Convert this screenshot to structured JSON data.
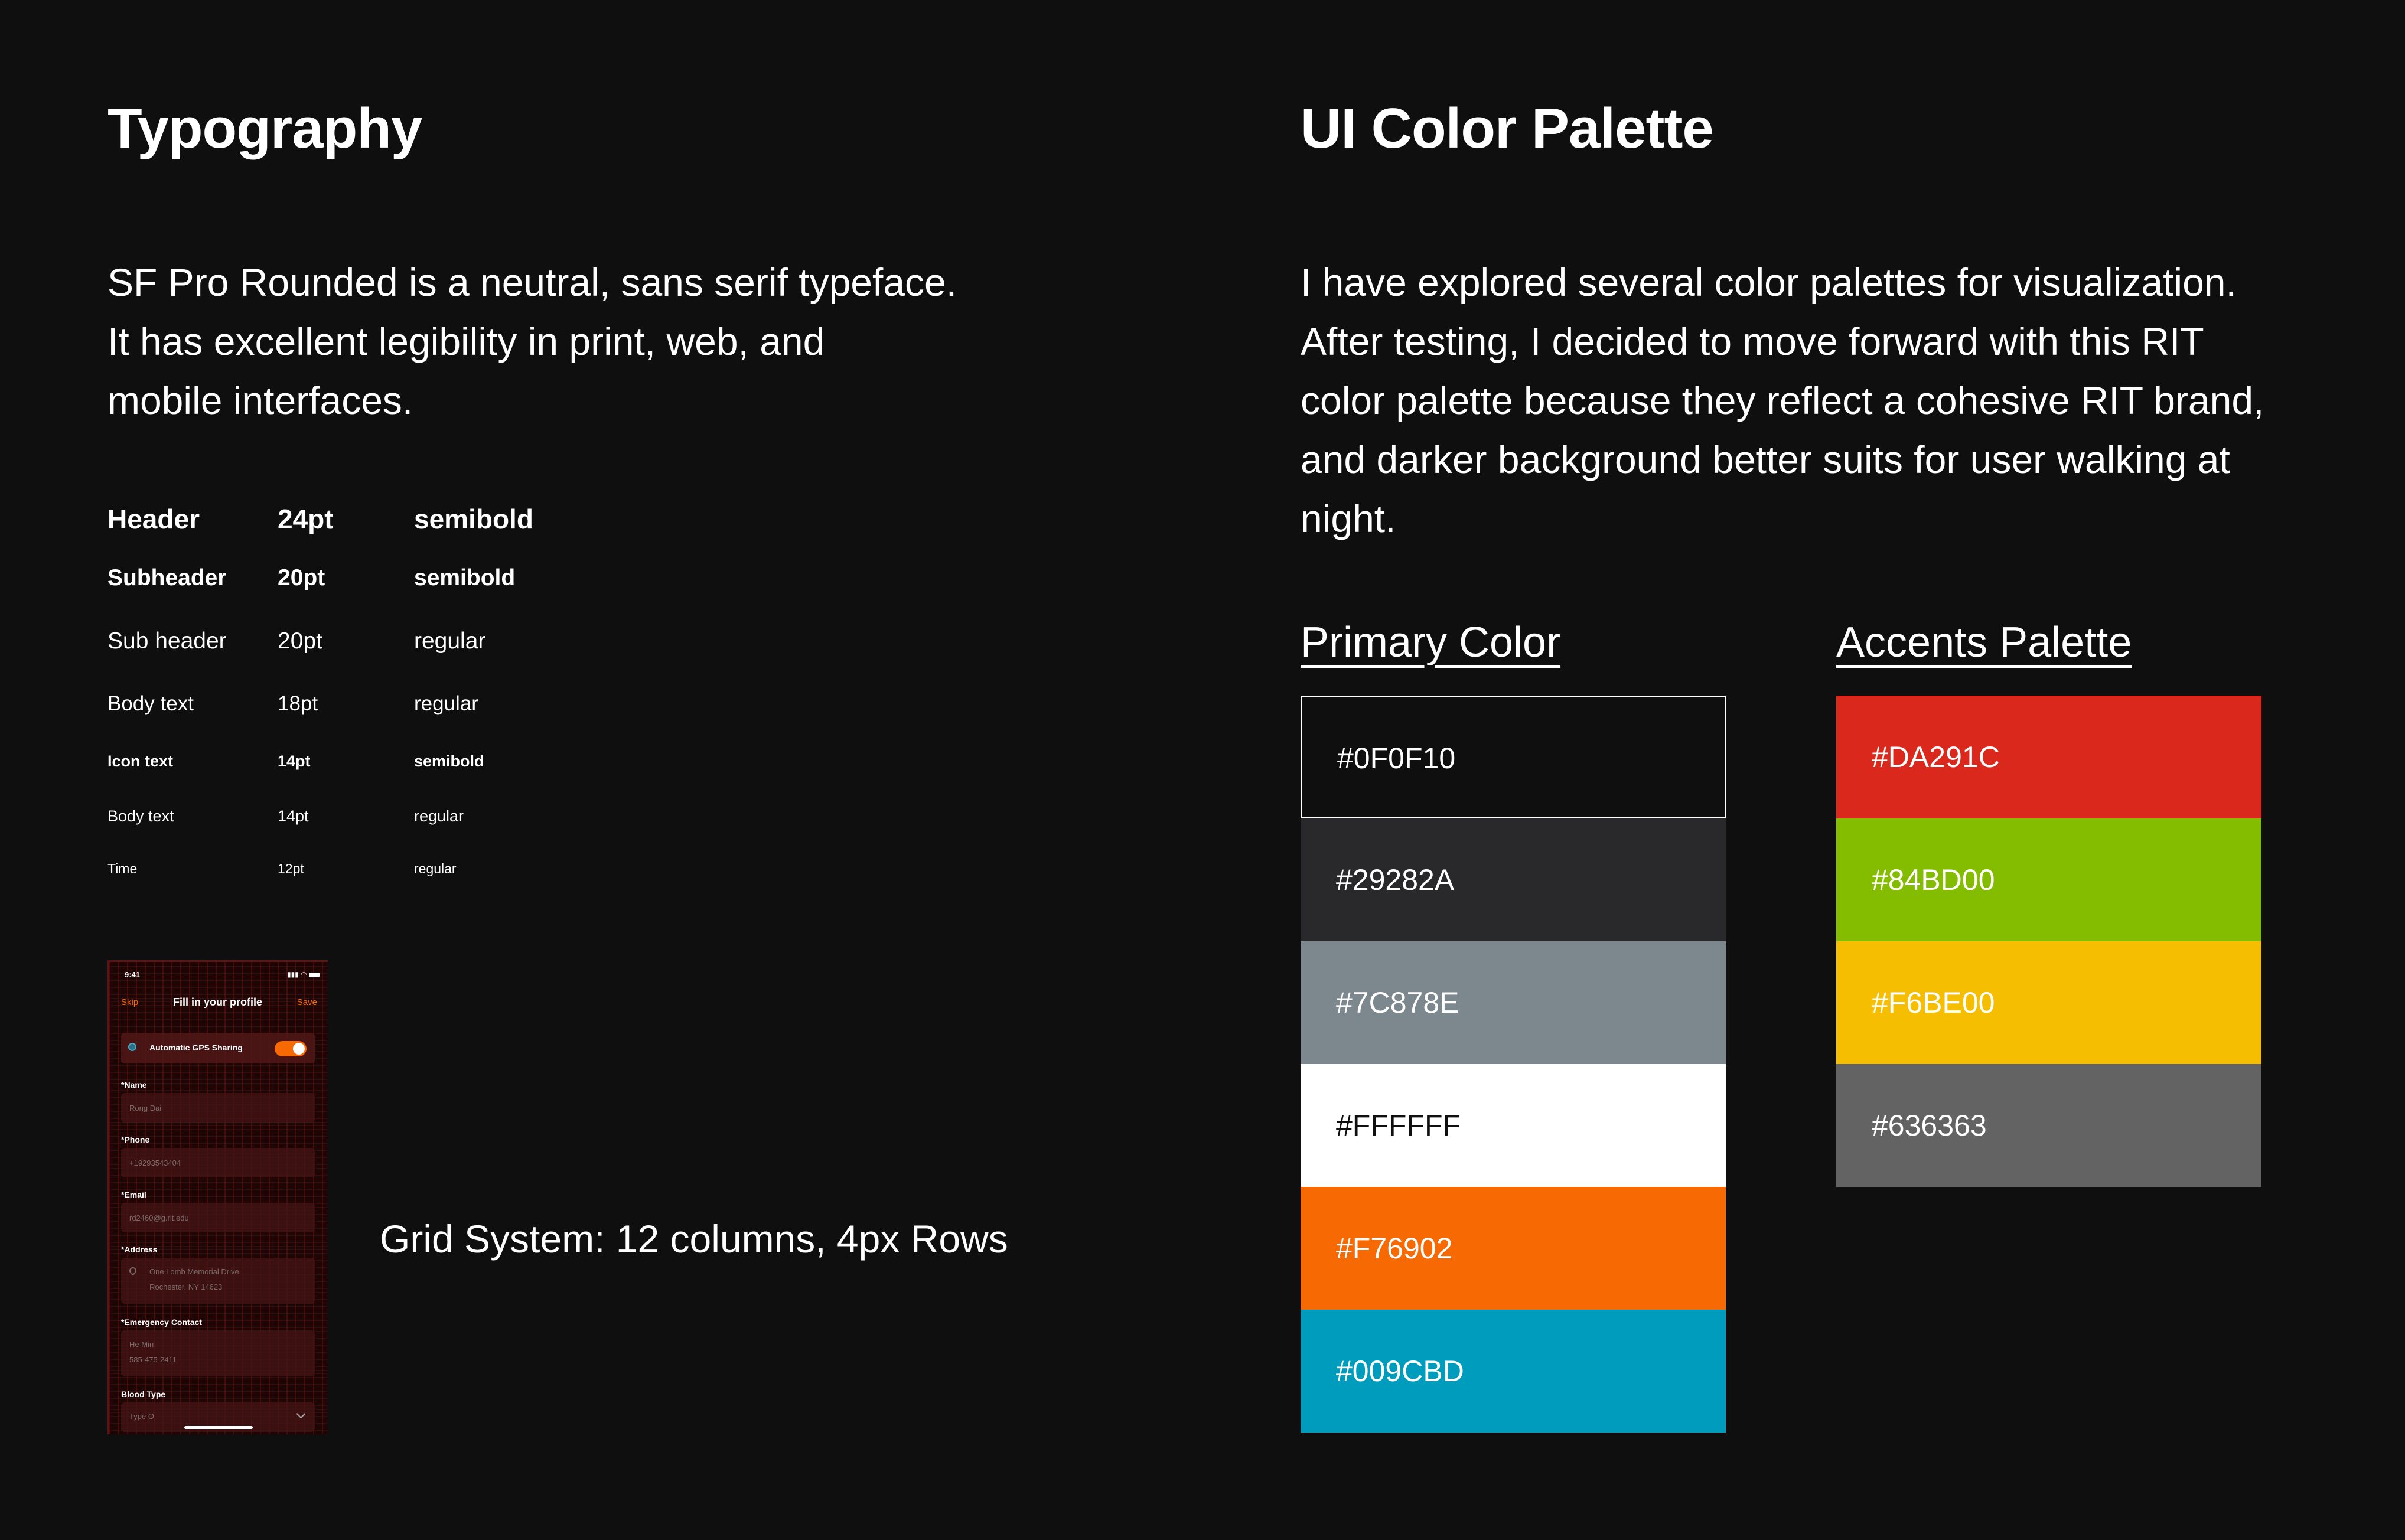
{
  "typography": {
    "title": "Typography",
    "intro_lines": [
      "SF Pro Rounded is a neutral, sans serif typeface.",
      "It has excellent legibility in print, web, and",
      "mobile interfaces."
    ],
    "rows": [
      {
        "name": "Header",
        "size": "24pt",
        "weight": "semibold"
      },
      {
        "name": "Subheader",
        "size": "20pt",
        "weight": "semibold"
      },
      {
        "name": "Sub header",
        "size": "20pt",
        "weight": "regular"
      },
      {
        "name": "Body text",
        "size": "18pt",
        "weight": "regular"
      },
      {
        "name": "Icon text",
        "size": "14pt",
        "weight": "semibold"
      },
      {
        "name": "Body text",
        "size": "14pt",
        "weight": "regular"
      },
      {
        "name": "Time",
        "size": "12pt",
        "weight": "regular"
      }
    ],
    "grid_caption": "Grid System: 12 columns, 4px Rows"
  },
  "phone": {
    "time": "9:41",
    "skip": "Skip",
    "title": "Fill in your profile",
    "save": "Save",
    "gps_label": "Automatic GPS Sharing",
    "gps_toggle_on": true,
    "fields": [
      {
        "label": "*Name",
        "value": "Rong Dai"
      },
      {
        "label": "*Phone",
        "value": "+19293543404"
      },
      {
        "label": "*Email",
        "value": "rd2460@g.rit.edu"
      },
      {
        "label": "*Address",
        "value": "One Lomb Memorial Drive",
        "value2": "Rochester, NY 14623"
      },
      {
        "label": "*Emergency Contact",
        "value": "He Min",
        "value2": "585-475-2411"
      },
      {
        "label": "Blood Type",
        "value": "Type O"
      }
    ],
    "accent_color": "#F76902"
  },
  "palette": {
    "title": "UI Color Palette",
    "intro_lines": [
      "I have explored several color palettes for visualization.",
      "After testing, I decided to move forward with this RIT",
      "color palette because they reflect a cohesive RIT brand,",
      "and darker background better suits for user walking at",
      "night."
    ],
    "primary_title": "Primary Color",
    "accents_title": "Accents Palette",
    "primary": [
      {
        "hex": "#0F0F10",
        "text_color": "#FFFFFF"
      },
      {
        "hex": "#29282A",
        "text_color": "#FFFFFF"
      },
      {
        "hex": "#7C878E",
        "text_color": "#FFFFFF"
      },
      {
        "hex": "#FFFFFF",
        "text_color": "#0F0F10"
      },
      {
        "hex": "#F76902",
        "text_color": "#FFFFFF"
      },
      {
        "hex": "#009CBD",
        "text_color": "#FFFFFF"
      }
    ],
    "accents": [
      {
        "hex": "#DA291C",
        "text_color": "#FFFFFF"
      },
      {
        "hex": "#84BD00",
        "text_color": "#FFFFFF"
      },
      {
        "hex": "#F6BE00",
        "text_color": "#FFFFFF"
      },
      {
        "hex": "#636363",
        "text_color": "#FFFFFF"
      }
    ]
  }
}
